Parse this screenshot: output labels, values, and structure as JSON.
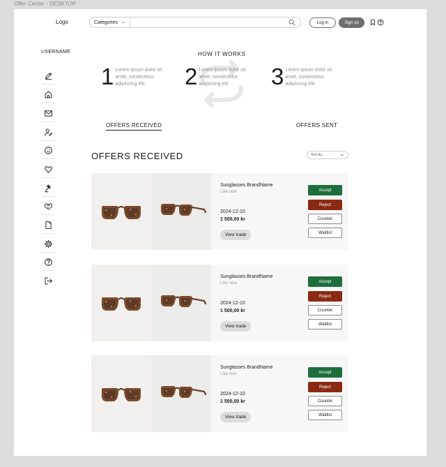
{
  "frame_title": "Offer Center - DESKTOP",
  "header": {
    "logo": "Logo",
    "categories_label": "Categories",
    "search_placeholder": "",
    "login_label": "Log in",
    "signup_label": "Sign up",
    "icons": [
      "bookmark-icon",
      "help-icon"
    ]
  },
  "sidebar": {
    "username": "USERNAME",
    "items": [
      "edit-icon",
      "home-icon",
      "mail-icon",
      "user-edit-icon",
      "smile-icon",
      "heart-icon",
      "gavel-icon",
      "handshake-icon",
      "document-icon",
      "settings-icon",
      "help-icon",
      "logout-icon"
    ]
  },
  "how_it_works": {
    "title": "HOW IT WORKS",
    "steps": [
      {
        "number": "1",
        "text": "Lorem ipsum dolor sit amet, consectetur adipiscing elit"
      },
      {
        "number": "2",
        "text": "Lorem ipsum dolor sit amet, consectetur adipiscing elit"
      },
      {
        "number": "3",
        "text": "Lorem ipsum dolor sit amet, consectetur adipiscing elit"
      }
    ]
  },
  "tabs": {
    "received": "OFFERS RECEIVED",
    "sent": "OFFERS SENT"
  },
  "section": {
    "title": "OFFERS RECEIVED",
    "sort_label": "Sort by..."
  },
  "offers": [
    {
      "brand": "Sunglasses BrandName",
      "condition": "Like new",
      "date": "2024-12-10",
      "price": "1 500,00 kr",
      "view_label": "View trade",
      "accept": "Accept",
      "reject": "Reject",
      "counter": "Counter",
      "waitlist": "Waitlist"
    },
    {
      "brand": "Sunglasses BrandName",
      "condition": "Like new",
      "date": "2024-12-10",
      "price": "1 500,00 kr",
      "view_label": "View trade",
      "accept": "Accept",
      "reject": "Reject",
      "counter": "Counter",
      "waitlist": "Waitlist"
    },
    {
      "brand": "Sunglasses BrandName",
      "condition": "Like new",
      "date": "2024-12-10",
      "price": "1 500,00 kr",
      "view_label": "View trade",
      "accept": "Accept",
      "reject": "Reject",
      "counter": "Counter",
      "waitlist": "Waitlist"
    }
  ],
  "colors": {
    "accept": "#1e6e3d",
    "reject": "#8b2a12",
    "signup": "#6e6e6e"
  }
}
